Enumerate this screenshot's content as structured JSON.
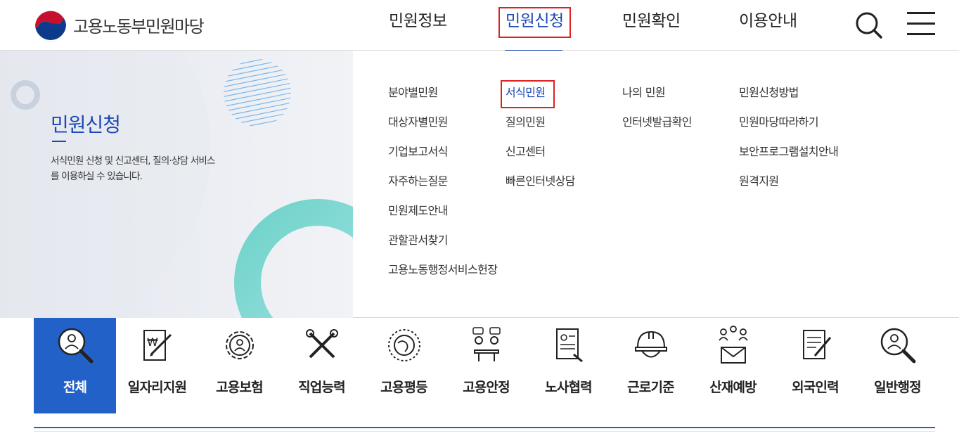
{
  "site": {
    "name": "고용노동부민원마당"
  },
  "gnb": {
    "items": [
      {
        "label": "민원정보"
      },
      {
        "label": "민원신청",
        "active": true
      },
      {
        "label": "민원확인"
      },
      {
        "label": "이용안내"
      }
    ],
    "search_icon": "search-icon",
    "menu_icon": "hamburger-icon"
  },
  "panel": {
    "title": "민원신청",
    "description": "서식민원 신청 및 신고센터, 질의·상담 서비스를 이용하실 수 있습니다.",
    "columns": [
      [
        "분야별민원",
        "대상자별민원",
        "기업보고서식",
        "자주하는질문",
        "민원제도안내",
        "관할관서찾기",
        "고용노동행정서비스헌장"
      ],
      [
        "서식민원",
        "질의민원",
        "신고센터",
        "빠른인터넷상담"
      ],
      [
        "나의 민원",
        "인터넷발급확인"
      ],
      [
        "민원신청방법",
        "민원마당따라하기",
        "보안프로그램설치안내",
        "원격지원"
      ]
    ],
    "active_link": "서식민원"
  },
  "categories": [
    {
      "label": "전체",
      "icon": "magnifier-person-icon",
      "active": true
    },
    {
      "label": "일자리지원",
      "icon": "document-pen-icon"
    },
    {
      "label": "고용보험",
      "icon": "gear-person-icon"
    },
    {
      "label": "직업능력",
      "icon": "tools-icon"
    },
    {
      "label": "고용평등",
      "icon": "globe-people-icon"
    },
    {
      "label": "고용안정",
      "icon": "meeting-icon"
    },
    {
      "label": "노사협력",
      "icon": "contract-icon"
    },
    {
      "label": "근로기준",
      "icon": "helmet-icon"
    },
    {
      "label": "산재예방",
      "icon": "people-mail-icon"
    },
    {
      "label": "외국인력",
      "icon": "document-pencil-icon"
    },
    {
      "label": "일반행정",
      "icon": "magnifier-person-icon"
    }
  ],
  "colors": {
    "accent": "#1d47b6",
    "category_active": "#2261c7",
    "highlight": "#e02020"
  }
}
